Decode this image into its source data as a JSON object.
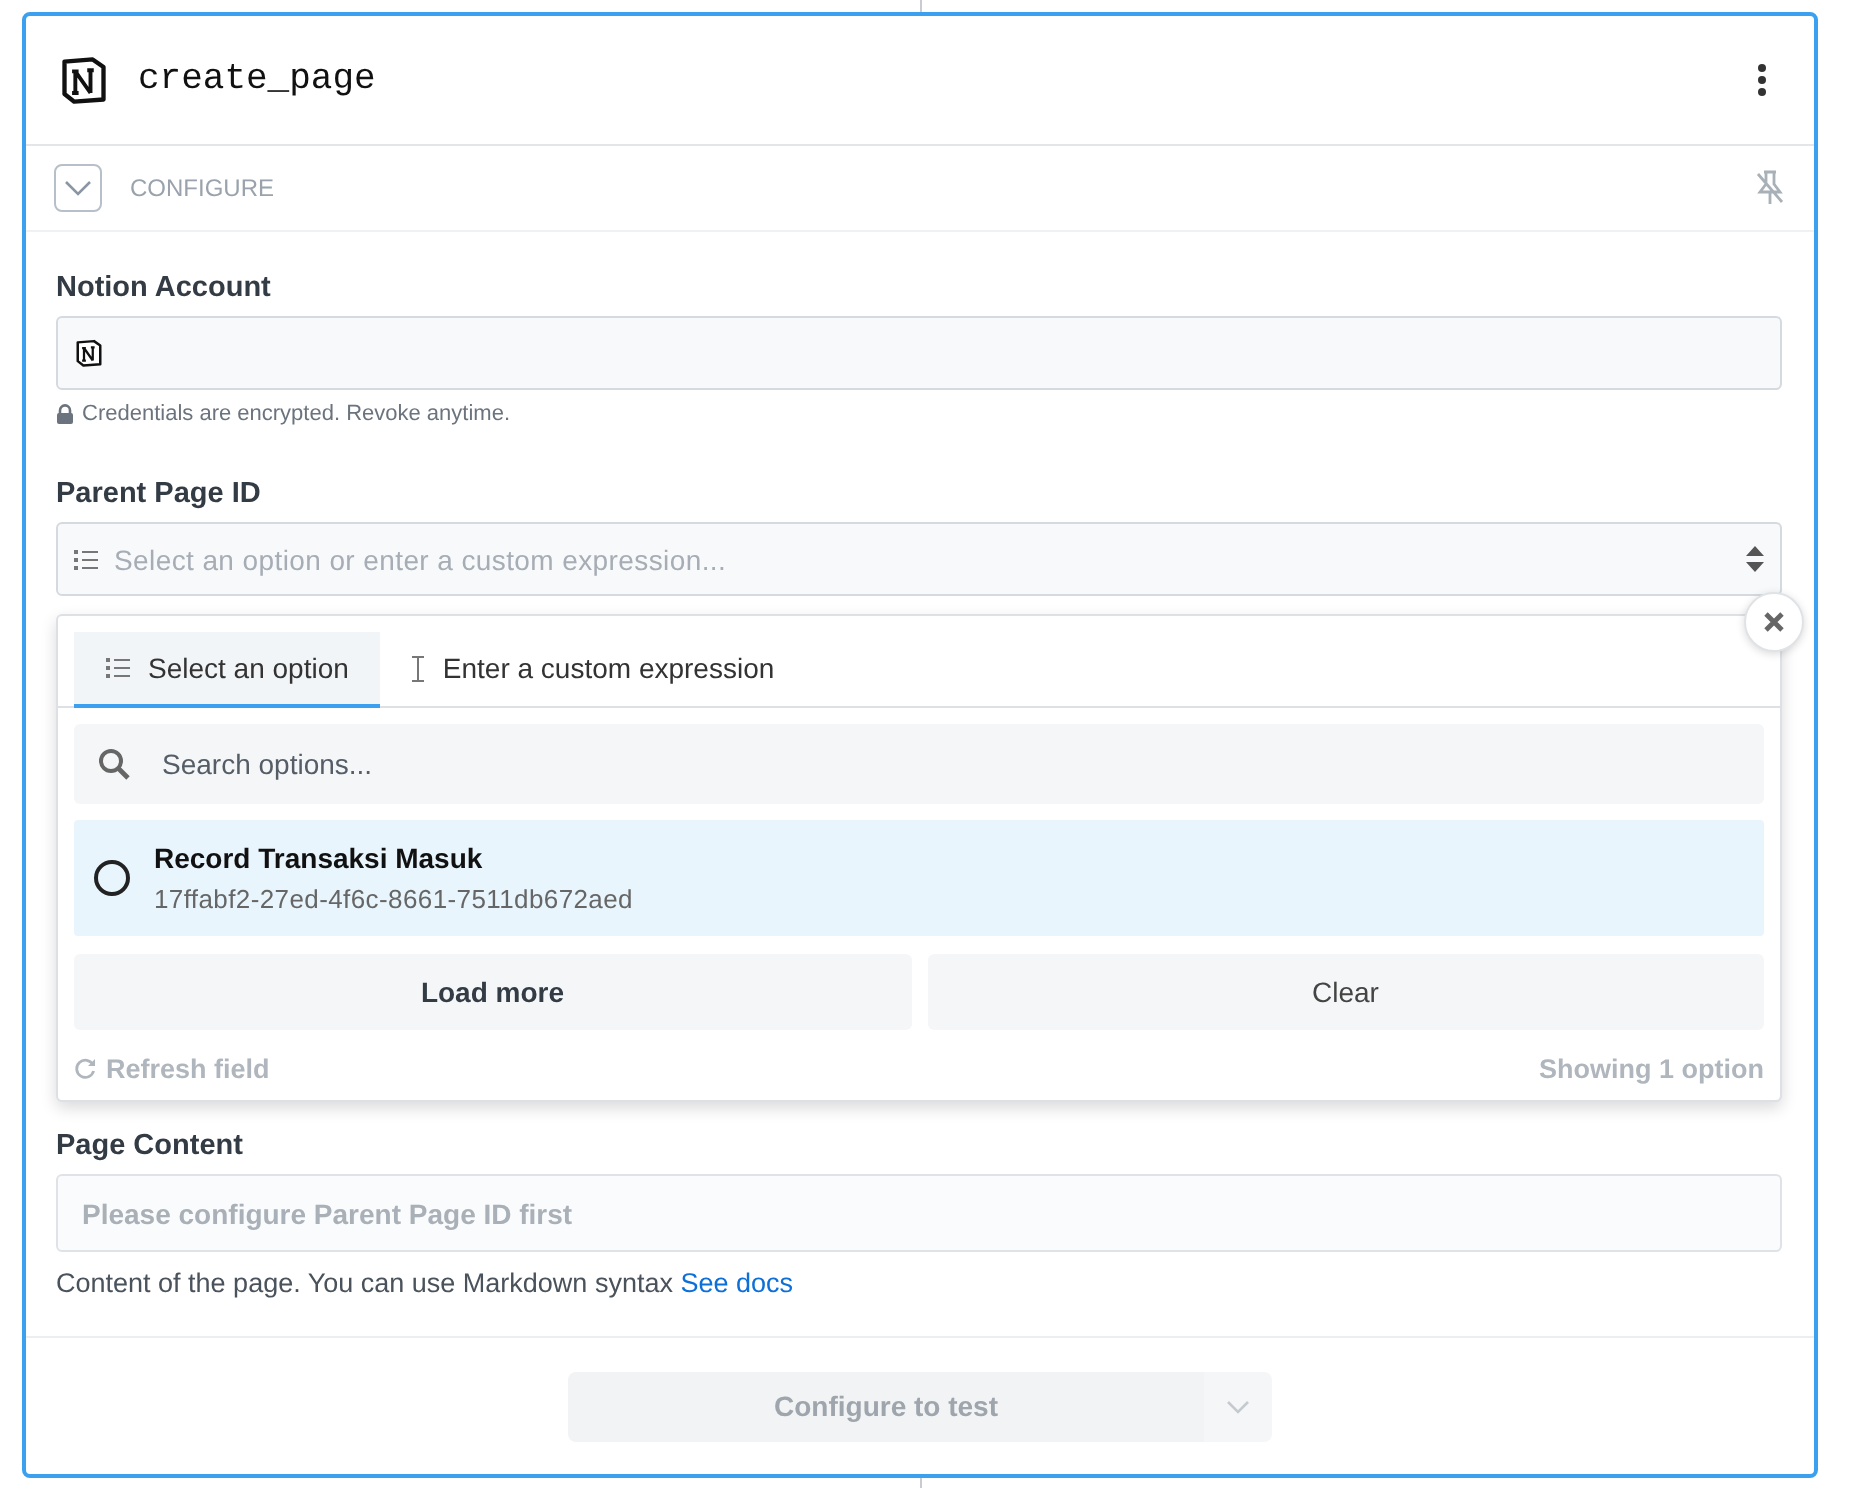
{
  "node": {
    "title": "create_page"
  },
  "section": {
    "label": "CONFIGURE",
    "expanded": true
  },
  "account_field": {
    "label": "Notion Account",
    "note": "Credentials are encrypted. Revoke anytime."
  },
  "parent_field": {
    "label": "Parent Page ID",
    "placeholder": "Select an option or enter a custom expression..."
  },
  "dropdown": {
    "tabs": [
      {
        "label": "Select an option",
        "selected": true
      },
      {
        "label": "Enter a custom expression",
        "selected": false
      }
    ],
    "search": {
      "placeholder": "Search options..."
    },
    "options": [
      {
        "name": "Record Transaksi Masuk",
        "id": "17ffabf2-27ed-4f6c-8661-7511db672aed",
        "selected": false,
        "highlighted": true
      }
    ],
    "buttons": [
      "Load more",
      "Clear"
    ],
    "refresh": "Refresh field",
    "count": "Showing 1 option"
  },
  "content_field": {
    "label": "Page Content",
    "placeholder": "Please configure Parent Page ID first",
    "help": "Content of the page. You can use Markdown syntax",
    "link": "See docs"
  },
  "test_button": {
    "label": "Configure to test",
    "disabled": true
  }
}
